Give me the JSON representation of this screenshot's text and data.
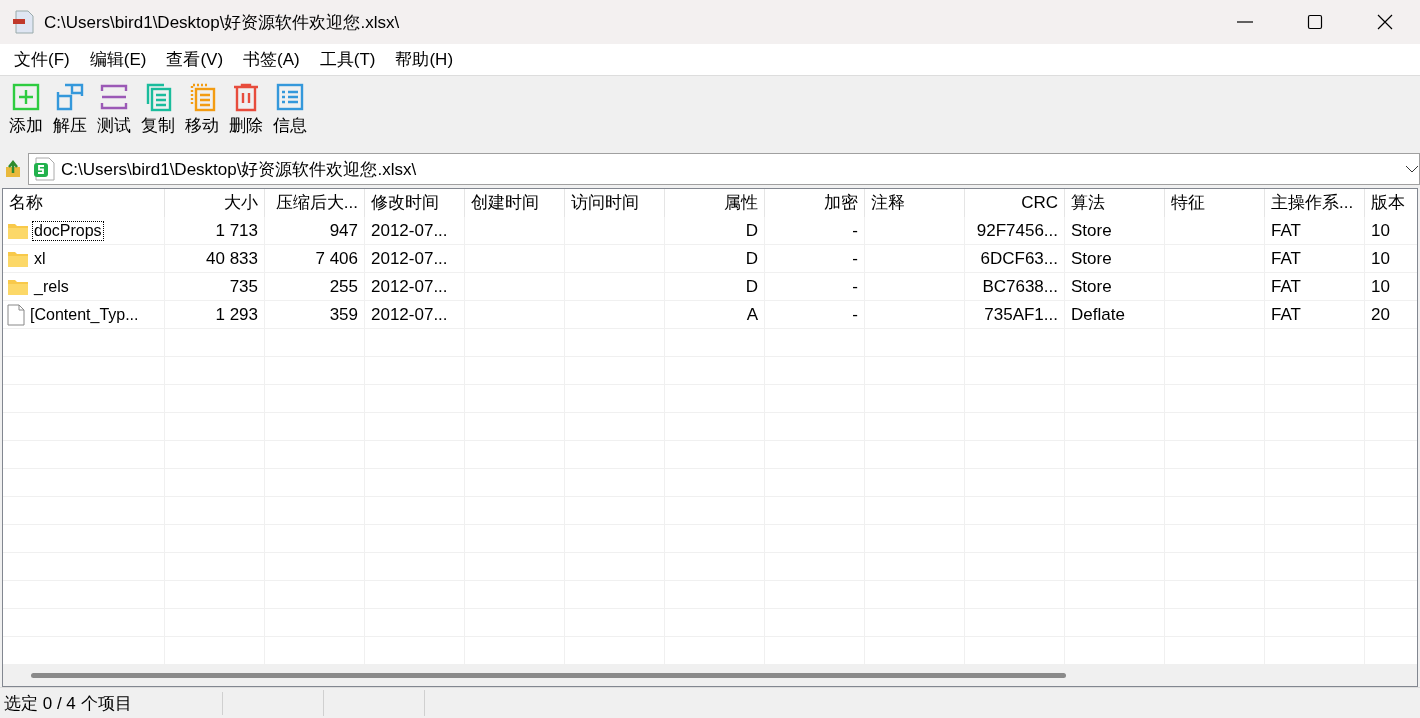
{
  "window": {
    "title": "C:\\Users\\bird1\\Desktop\\好资源软件欢迎您.xlsx\\"
  },
  "menu": [
    "文件(F)",
    "编辑(E)",
    "查看(V)",
    "书签(A)",
    "工具(T)",
    "帮助(H)"
  ],
  "toolbar": [
    {
      "kind": "add",
      "label": "添加"
    },
    {
      "kind": "extract",
      "label": "解压"
    },
    {
      "kind": "test",
      "label": "测试"
    },
    {
      "kind": "copy",
      "label": "复制"
    },
    {
      "kind": "move",
      "label": "移动"
    },
    {
      "kind": "delete",
      "label": "删除"
    },
    {
      "kind": "info",
      "label": "信息"
    }
  ],
  "address": {
    "value": "C:\\Users\\bird1\\Desktop\\好资源软件欢迎您.xlsx\\"
  },
  "table": {
    "columns": [
      {
        "label": "名称",
        "kind": "text"
      },
      {
        "label": "大小",
        "kind": "number"
      },
      {
        "label": "压缩后大...",
        "kind": "number"
      },
      {
        "label": "修改时间",
        "kind": "text"
      },
      {
        "label": "创建时间",
        "kind": "text"
      },
      {
        "label": "访问时间",
        "kind": "text"
      },
      {
        "label": "属性",
        "kind": "number"
      },
      {
        "label": "加密",
        "kind": "number"
      },
      {
        "label": "注释",
        "kind": "text"
      },
      {
        "label": "CRC",
        "kind": "number"
      },
      {
        "label": "算法",
        "kind": "text"
      },
      {
        "label": "特征",
        "kind": "text"
      },
      {
        "label": "主操作系...",
        "kind": "text"
      },
      {
        "label": "版本",
        "kind": "text"
      }
    ],
    "rows": [
      {
        "kind": "folder",
        "focused": true,
        "cells": [
          "docProps",
          "1 713",
          "947",
          "2012-07...",
          "",
          "",
          "D",
          "-",
          "",
          "92F7456...",
          "Store",
          "",
          "FAT",
          "10"
        ]
      },
      {
        "kind": "folder",
        "focused": false,
        "cells": [
          "xl",
          "40 833",
          "7 406",
          "2012-07...",
          "",
          "",
          "D",
          "-",
          "",
          "6DCF63...",
          "Store",
          "",
          "FAT",
          "10"
        ]
      },
      {
        "kind": "folder",
        "focused": false,
        "cells": [
          "_rels",
          "735",
          "255",
          "2012-07...",
          "",
          "",
          "D",
          "-",
          "",
          "BC7638...",
          "Store",
          "",
          "FAT",
          "10"
        ]
      },
      {
        "kind": "file",
        "focused": false,
        "cells": [
          "[Content_Typ...",
          "1 293",
          "359",
          "2012-07...",
          "",
          "",
          "A",
          "-",
          "",
          "735AF1...",
          "Deflate",
          "",
          "FAT",
          "20"
        ]
      }
    ]
  },
  "status_bar": {
    "text": "选定 0 / 4 个项目"
  }
}
